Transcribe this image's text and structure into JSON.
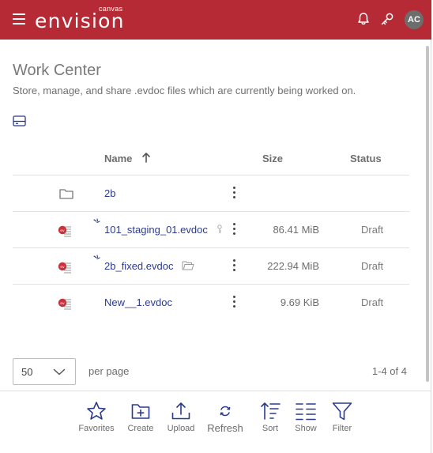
{
  "header": {
    "logo_main": "envision",
    "logo_sub": "canvas",
    "avatar_initials": "AC",
    "brand_color": "#b52a35"
  },
  "page": {
    "title": "Work Center",
    "subtitle": "Store, manage, and share .evdoc files which are currently being worked on."
  },
  "table": {
    "columns": {
      "name": "Name",
      "size": "Size",
      "status": "Status"
    },
    "sort": {
      "column": "Name",
      "direction": "ascending"
    },
    "rows": [
      {
        "type": "folder",
        "name": "2b",
        "size": "",
        "status": ""
      },
      {
        "type": "evdoc",
        "name": "101_staging_01.evdoc",
        "size": "86.41 MiB",
        "status": "Draft",
        "badge": "key-icon"
      },
      {
        "type": "evdoc",
        "name": "2b_fixed.evdoc",
        "size": "222.94 MiB",
        "status": "Draft",
        "badge": "folder-outline-icon"
      },
      {
        "type": "evdoc",
        "name": "New__1.evdoc",
        "size": "9.69 KiB",
        "status": "Draft"
      }
    ]
  },
  "pagination": {
    "per_page_value": "50",
    "per_page_label": "per page",
    "range": "1-4 of 4"
  },
  "toolbar": {
    "favorites": "Favorites",
    "create": "Create",
    "upload": "Upload",
    "refresh": "Refresh",
    "sort": "Sort",
    "show": "Show",
    "filter": "Filter",
    "accent": "#2b3a8e"
  }
}
